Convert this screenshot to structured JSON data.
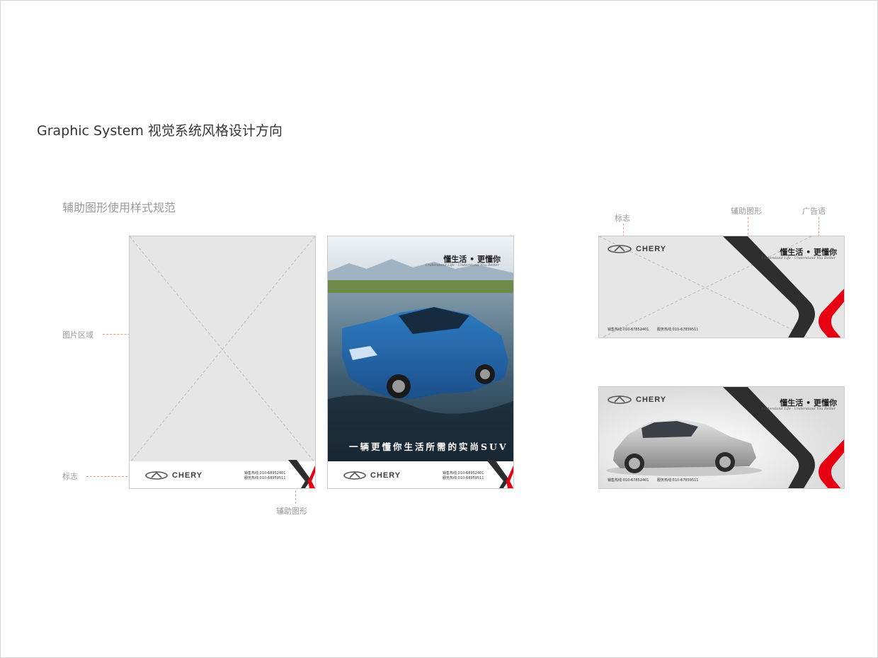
{
  "page": {
    "title": "Graphic System 视觉系统风格设计方向",
    "subtitle": "辅助图形使用样式规范"
  },
  "annotations": {
    "picture_area": "图片区域",
    "logo_left": "标志",
    "aux_graphic_bottom": "辅助图形",
    "logo_right": "标志",
    "aux_graphic_top": "辅助图形",
    "ad_slogan": "广告语"
  },
  "brand": {
    "name": "CHERY",
    "slogan": "懂生活 • 更懂你",
    "slogan_en": "Understand Life · Understand You Better",
    "red": "#e60012",
    "dark": "#2d2d2d"
  },
  "poster_template": {
    "sales_line": "销售热线:010-68952401",
    "service_line": "服务热线:010-68959511"
  },
  "poster_photo": {
    "headline": "一辆更懂你生活所需的实尚SUV",
    "sales_line": "销售热线:010-68952401",
    "service_line": "服务热线:010-68959511"
  },
  "banner_template": {
    "sales_line": "销售热线:010-67852401",
    "service_line": "服务热线:010-67859511"
  },
  "banner_photo": {
    "sales_line": "销售热线:010-67852401",
    "service_line": "服务热线:010-67859511"
  }
}
